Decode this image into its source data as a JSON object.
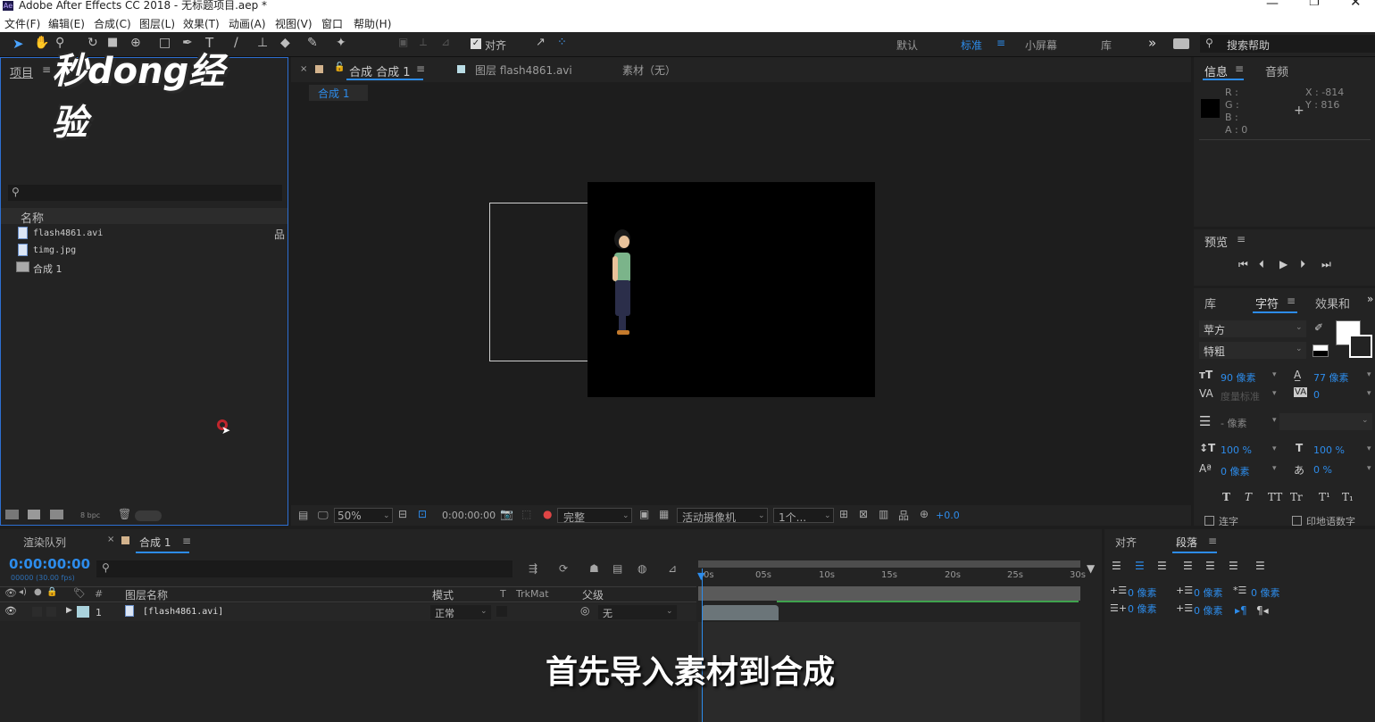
{
  "window": {
    "title": "Adobe After Effects CC 2018 - 无标题项目.aep *",
    "app_icon": "Ae"
  },
  "menu": [
    "文件(F)",
    "编辑(E)",
    "合成(C)",
    "图层(L)",
    "效果(T)",
    "动画(A)",
    "视图(V)",
    "窗口",
    "帮助(H)"
  ],
  "toolbar": {
    "snap_label": "对齐",
    "workspaces": [
      "默认",
      "标准",
      "小屏幕",
      "库"
    ],
    "active_workspace": "标准",
    "search_placeholder": "搜索帮助",
    "more": "»"
  },
  "watermark": "秒dong经验",
  "project": {
    "tab": "项目",
    "col_name": "名称",
    "items": [
      {
        "name": "flash4861.avi",
        "icon": "video-file-icon"
      },
      {
        "name": "timg.jpg",
        "icon": "image-file-icon"
      },
      {
        "name": "合成 1",
        "icon": "composition-icon"
      }
    ],
    "bpc": "8 bpc"
  },
  "viewer": {
    "tabs": [
      {
        "label": "合成 合成 1",
        "active": true
      },
      {
        "label": "图层 flash4861.avi"
      },
      {
        "label": "素材（无）"
      }
    ],
    "breadcrumb": "合成 1",
    "zoom": "50%",
    "timecode": "0:00:00:00",
    "resolution": "完整",
    "camera": "活动摄像机",
    "views": "1个...",
    "exposure": "+0.0"
  },
  "info": {
    "tab": "信息",
    "tab2": "音频",
    "r": "R :",
    "g": "G :",
    "b": "B :",
    "a": "A : 0",
    "x": "X : -814",
    "y": "Y : 816"
  },
  "preview": {
    "tab": "预览"
  },
  "character": {
    "tabs": [
      "库",
      "字符",
      "效果和"
    ],
    "font": "苹方",
    "style": "特粗",
    "size": "90 像素",
    "leading": "77 像素",
    "kerning": "度量标准",
    "tracking": "0",
    "stroke": "- 像素",
    "vscale": "100 %",
    "hscale": "100 %",
    "baseline": "0 像素",
    "tsume": "0 %",
    "styles": [
      "T",
      "T",
      "TT",
      "Tr",
      "T¹",
      "T₁"
    ],
    "check1": "连字",
    "check2": "印地语数字"
  },
  "timeline": {
    "tabs": [
      "渲染队列",
      "合成 1"
    ],
    "timecode": "0:00:00:00",
    "timecode_sub": "00000 (30.00 fps)",
    "cols": {
      "num": "#",
      "layer_name": "图层名称",
      "mode": "模式",
      "t": "T",
      "trkmat": "TrkMat",
      "parent": "父级"
    },
    "layers": [
      {
        "num": "1",
        "name": "[flash4861.avi]",
        "mode": "正常",
        "parent": "无"
      }
    ],
    "ruler": [
      "0s",
      "05s",
      "10s",
      "15s",
      "20s",
      "25s",
      "30s"
    ]
  },
  "paragraph": {
    "tabs": [
      "对齐",
      "段落"
    ],
    "indent": "0 像素"
  },
  "subtitle": "首先导入素材到合成"
}
